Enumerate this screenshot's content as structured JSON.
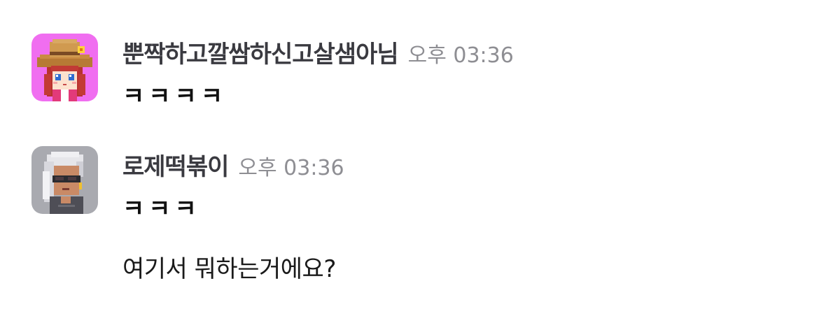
{
  "messages": [
    {
      "username": "뿐짝하고깔쌈하신고살샘아님",
      "time": "오후 03:36",
      "texts": [
        "ㅋㅋㅋㅋ"
      ],
      "avatar_icon": "straw-hat-girl-avatar",
      "avatar_bg": "#f06ef0"
    },
    {
      "username": "로제떡볶이",
      "time": "오후 03:36",
      "texts": [
        "ㅋㅋㅋ",
        "여기서 뭐하는거에요?"
      ],
      "avatar_icon": "sunglasses-character-avatar",
      "avatar_bg": "#a9aab0"
    }
  ]
}
